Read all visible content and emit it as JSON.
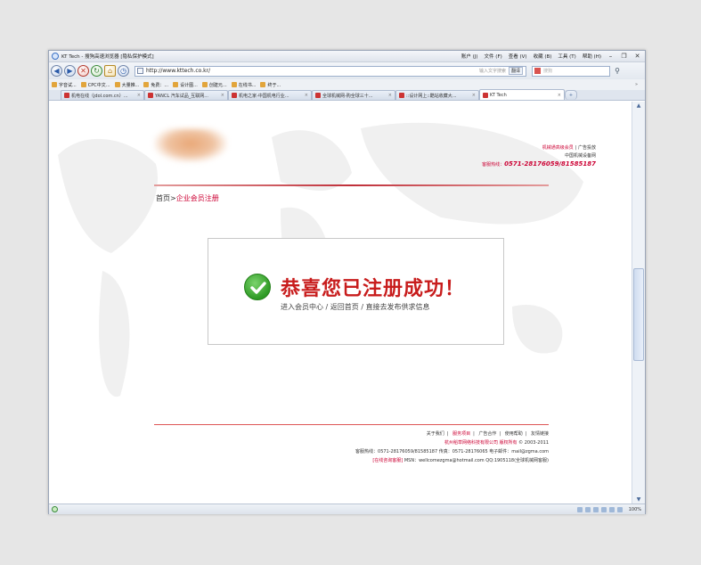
{
  "window": {
    "title": "KT Tech - 搜狗高速浏览器 [隐私保护模式]",
    "menus": [
      "账户 (J)",
      "文件 (F)",
      "查看 (V)",
      "收藏 (B)",
      "工具 (T)",
      "帮助 (H)"
    ]
  },
  "nav": {
    "url": "http://www.kttech.co.kr/",
    "address_hint": "输入文字搜索",
    "address_badge": "翻译",
    "search_placeholder": "搜狗"
  },
  "favorites": [
    "字音试...",
    "CPC中文...",
    "大量推...",
    "免费：...",
    "设计图...",
    "创建元...",
    "在线书...",
    "终于..."
  ],
  "favorites_more": "»",
  "tabs": [
    {
      "label": "机电在线（jdol.com.cn）...",
      "active": false
    },
    {
      "label": "YANCL 汽车试品_互联网...",
      "active": false
    },
    {
      "label": "机电之家-中国机电行业...",
      "active": false
    },
    {
      "label": "全球机械网-购全球三十...",
      "active": false
    },
    {
      "label": "::设计网上::酷站收藏大...",
      "active": false
    },
    {
      "label": "KT Tech",
      "active": true
    }
  ],
  "site_header": {
    "links": [
      "机械通高级会员",
      "广告投放"
    ],
    "subtitle": "中国机械设备网",
    "hotline_label": "客服热线：",
    "hotline_number": "0571-28176059/81585187"
  },
  "breadcrumb": {
    "home": "首页",
    "separator": ">",
    "current": "企业会员注册"
  },
  "success": {
    "title": "恭喜您已注册成功！",
    "link_member_center": "进入会员中心",
    "link_home": "返回首页",
    "link_publish": "直接去发布供求信息",
    "separator": " / "
  },
  "footer": {
    "nav": [
      "关于我们",
      "服务项目",
      "广告合作",
      "使用帮助",
      "友情链接"
    ],
    "company": "杭州稻草网络科技有限公司 版权所有",
    "copyright": "© 2003-2011",
    "contact": "客服热线：0571-28176059/81585187  传真：0571-28176065  电子邮件：mail@zgma.com",
    "msn_label": "[在线咨询客服]",
    "msn": "MSN：wellcomezgma@hotmail.com   QQ:1905118(全球机械网客服)"
  },
  "status": {
    "zoom": "100%"
  }
}
